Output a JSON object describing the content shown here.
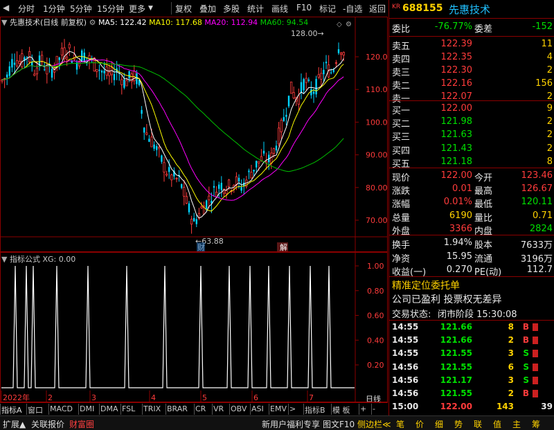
{
  "toolbar": {
    "left_items": [
      "分时",
      "1分钟",
      "5分钟",
      "15分钟",
      "更多"
    ],
    "right_items": [
      "复权",
      "叠加",
      "多股",
      "统计",
      "画线",
      "F10",
      "标记",
      "-自选",
      "返回"
    ]
  },
  "chart": {
    "name": "先惠技术",
    "mode": "(日线 前复权)",
    "ma5_label": "MA5: 122.42",
    "ma10_label": "MA10: 117.68",
    "ma20_label": "MA20: 112.94",
    "ma60_label": "MA60: 94.54",
    "high_mark": "128.00",
    "low_mark": "63.88",
    "event1": "财",
    "event2": "解",
    "price_axis": [
      "120.0",
      "110.0",
      "100.0",
      "90.00",
      "80.00",
      "70.00"
    ],
    "date_axis": [
      "2022年",
      "2",
      "3",
      "4",
      "5",
      "6",
      "7"
    ],
    "colors": {
      "ma5": "#ffffff",
      "ma10": "#ffff00",
      "ma20": "#ff00ff",
      "ma60": "#00c000",
      "up": "#ff3c3c",
      "down": "#00d4ff"
    }
  },
  "indicator": {
    "title": "指标公式",
    "value": "XG: 0.00",
    "axis": [
      "1.00",
      "0.80",
      "0.60",
      "0.40",
      "0.20"
    ]
  },
  "tabs": [
    "指标A",
    "窗口",
    "MACD",
    "DMI",
    "DMA",
    "FSL",
    "TRIX",
    "BRAR",
    "CR",
    "VR",
    "OBV",
    "ASI",
    "EMV",
    ">",
    "指标B",
    "模 板",
    "+",
    "-",
    "日线"
  ],
  "statusbar": {
    "left": [
      "扩展▲",
      "关联报价",
      "财富圈"
    ],
    "middle": [
      "新用户福利专享",
      "图文F10",
      "侧边栏≪"
    ],
    "right": [
      "笔",
      "价",
      "细",
      "势",
      "联",
      "值",
      "主",
      "筹"
    ]
  },
  "quote": {
    "badge": "KR",
    "code": "688155",
    "name": "先惠技术",
    "weibi_label": "委比",
    "weibi": "-76.77%",
    "weicha_label": "委差",
    "weicha": "-152",
    "asks": [
      {
        "label": "卖五",
        "price": "122.39",
        "vol": "11"
      },
      {
        "label": "卖四",
        "price": "122.35",
        "vol": "4"
      },
      {
        "label": "卖三",
        "price": "122.30",
        "vol": "2"
      },
      {
        "label": "卖二",
        "price": "122.16",
        "vol": "156"
      },
      {
        "label": "卖一",
        "price": "122.07",
        "vol": "2"
      }
    ],
    "bids": [
      {
        "label": "买一",
        "price": "122.00",
        "vol": "9"
      },
      {
        "label": "买二",
        "price": "121.98",
        "vol": "2"
      },
      {
        "label": "买三",
        "price": "121.63",
        "vol": "2"
      },
      {
        "label": "买四",
        "price": "121.43",
        "vol": "2"
      },
      {
        "label": "买五",
        "price": "121.18",
        "vol": "8"
      }
    ],
    "stats": [
      {
        "l1": "现价",
        "v1": "122.00",
        "l2": "今开",
        "v2": "123.46"
      },
      {
        "l1": "涨跌",
        "v1": "0.01",
        "l2": "最高",
        "v2": "126.67"
      },
      {
        "l1": "涨幅",
        "v1": "0.01%",
        "l2": "最低",
        "v2": "120.11"
      },
      {
        "l1": "总量",
        "v1": "6190",
        "l2": "量比",
        "v2": "0.71"
      },
      {
        "l1": "外盘",
        "v1": "3366",
        "l2": "内盘",
        "v2": "2824"
      }
    ],
    "stats2": [
      {
        "l1": "换手",
        "v1": "1.94%",
        "l2": "股本",
        "v2": "7633万"
      },
      {
        "l1": "净资",
        "v1": "15.95",
        "l2": "流通",
        "v2": "3196万"
      },
      {
        "l1": "收益(一)",
        "v1": "0.270",
        "l2": "PE(动)",
        "v2": "112.7"
      }
    ],
    "notice1": "精准定位委托单",
    "notice2": "公司已盈利 投票权无差异",
    "trade_status_label": "交易状态:",
    "trade_status": "闭市阶段 15:30:08",
    "ticks": [
      {
        "t": "14:55",
        "p": "121.66",
        "v": "8",
        "d": "B"
      },
      {
        "t": "14:55",
        "p": "121.66",
        "v": "2",
        "d": "B"
      },
      {
        "t": "14:55",
        "p": "121.55",
        "v": "3",
        "d": "S"
      },
      {
        "t": "14:56",
        "p": "121.55",
        "v": "6",
        "d": "S"
      },
      {
        "t": "14:56",
        "p": "121.17",
        "v": "3",
        "d": "S"
      },
      {
        "t": "14:56",
        "p": "121.55",
        "v": "2",
        "d": "B"
      },
      {
        "t": "15:00",
        "p": "122.00",
        "v": "143",
        "d": "39"
      }
    ]
  }
}
